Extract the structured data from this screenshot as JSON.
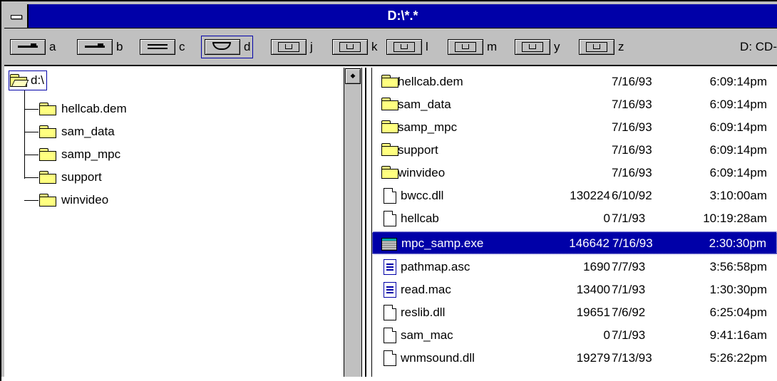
{
  "window": {
    "title": "D:\\*.*"
  },
  "drives": [
    {
      "letter": "a",
      "icon": "floppy-drive-icon"
    },
    {
      "letter": "b",
      "icon": "floppy-drive-icon"
    },
    {
      "letter": "c",
      "icon": "hard-drive-icon"
    },
    {
      "letter": "d",
      "icon": "cdrom-drive-icon",
      "selected": true
    },
    {
      "letter": "j",
      "icon": "network-drive-icon"
    },
    {
      "letter": "k",
      "icon": "network-drive-icon"
    },
    {
      "letter": "l",
      "icon": "network-drive-icon"
    },
    {
      "letter": "m",
      "icon": "network-drive-icon"
    },
    {
      "letter": "y",
      "icon": "network-drive-icon"
    },
    {
      "letter": "z",
      "icon": "network-drive-icon"
    }
  ],
  "drive_label": "D: CD-",
  "tree": {
    "root": "d:\\",
    "items": [
      "hellcab.dem",
      "sam_data",
      "samp_mpc",
      "support",
      "winvideo"
    ]
  },
  "files": [
    {
      "name": "hellcab.dem",
      "size": "",
      "date": "7/16/93",
      "time": "6:09:14pm",
      "type": "folder"
    },
    {
      "name": "sam_data",
      "size": "",
      "date": "7/16/93",
      "time": "6:09:14pm",
      "type": "folder"
    },
    {
      "name": "samp_mpc",
      "size": "",
      "date": "7/16/93",
      "time": "6:09:14pm",
      "type": "folder"
    },
    {
      "name": "support",
      "size": "",
      "date": "7/16/93",
      "time": "6:09:14pm",
      "type": "folder"
    },
    {
      "name": "winvideo",
      "size": "",
      "date": "7/16/93",
      "time": "6:09:14pm",
      "type": "folder"
    },
    {
      "name": "bwcc.dll",
      "size": "130224",
      "date": "6/10/92",
      "time": "3:10:00am",
      "type": "file"
    },
    {
      "name": "hellcab",
      "size": "0",
      "date": "7/1/93",
      "time": "10:19:28am",
      "type": "file"
    },
    {
      "name": "mpc_samp.exe",
      "size": "146642",
      "date": "7/16/93",
      "time": "2:30:30pm",
      "type": "exe",
      "selected": true
    },
    {
      "name": "pathmap.asc",
      "size": "1690",
      "date": "7/7/93",
      "time": "3:56:58pm",
      "type": "text"
    },
    {
      "name": "read.mac",
      "size": "13400",
      "date": "7/1/93",
      "time": "1:30:30pm",
      "type": "text"
    },
    {
      "name": "reslib.dll",
      "size": "19651",
      "date": "7/6/92",
      "time": "6:25:04pm",
      "type": "file"
    },
    {
      "name": "sam_mac",
      "size": "0",
      "date": "7/1/93",
      "time": "9:41:16am",
      "type": "file"
    },
    {
      "name": "wnmsound.dll",
      "size": "19279",
      "date": "7/13/93",
      "time": "5:26:22pm",
      "type": "file"
    }
  ]
}
